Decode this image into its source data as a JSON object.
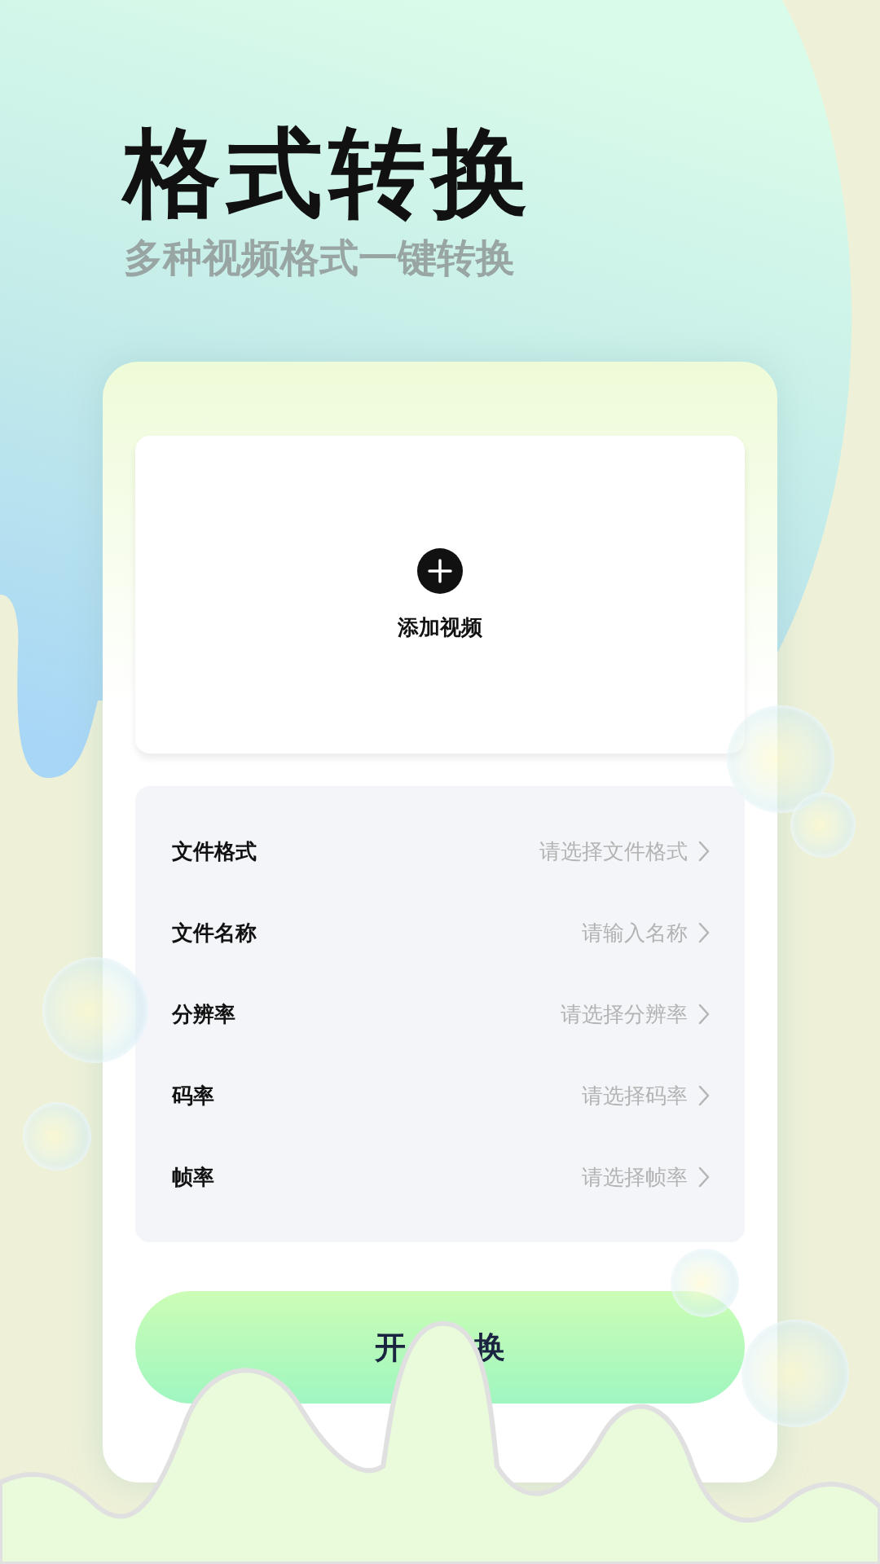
{
  "title": "格式转换",
  "subtitle": "多种视频格式一键转换",
  "upload": {
    "label": "添加视频"
  },
  "settings": [
    {
      "label": "文件格式",
      "placeholder": "请选择文件格式"
    },
    {
      "label": "文件名称",
      "placeholder": "请输入名称"
    },
    {
      "label": "分辨率",
      "placeholder": "请选择分辨率"
    },
    {
      "label": "码率",
      "placeholder": "请选择码率"
    },
    {
      "label": "帧率",
      "placeholder": "请选择帧率"
    }
  ],
  "start_button": {
    "label_parts": [
      "开",
      "换"
    ]
  }
}
